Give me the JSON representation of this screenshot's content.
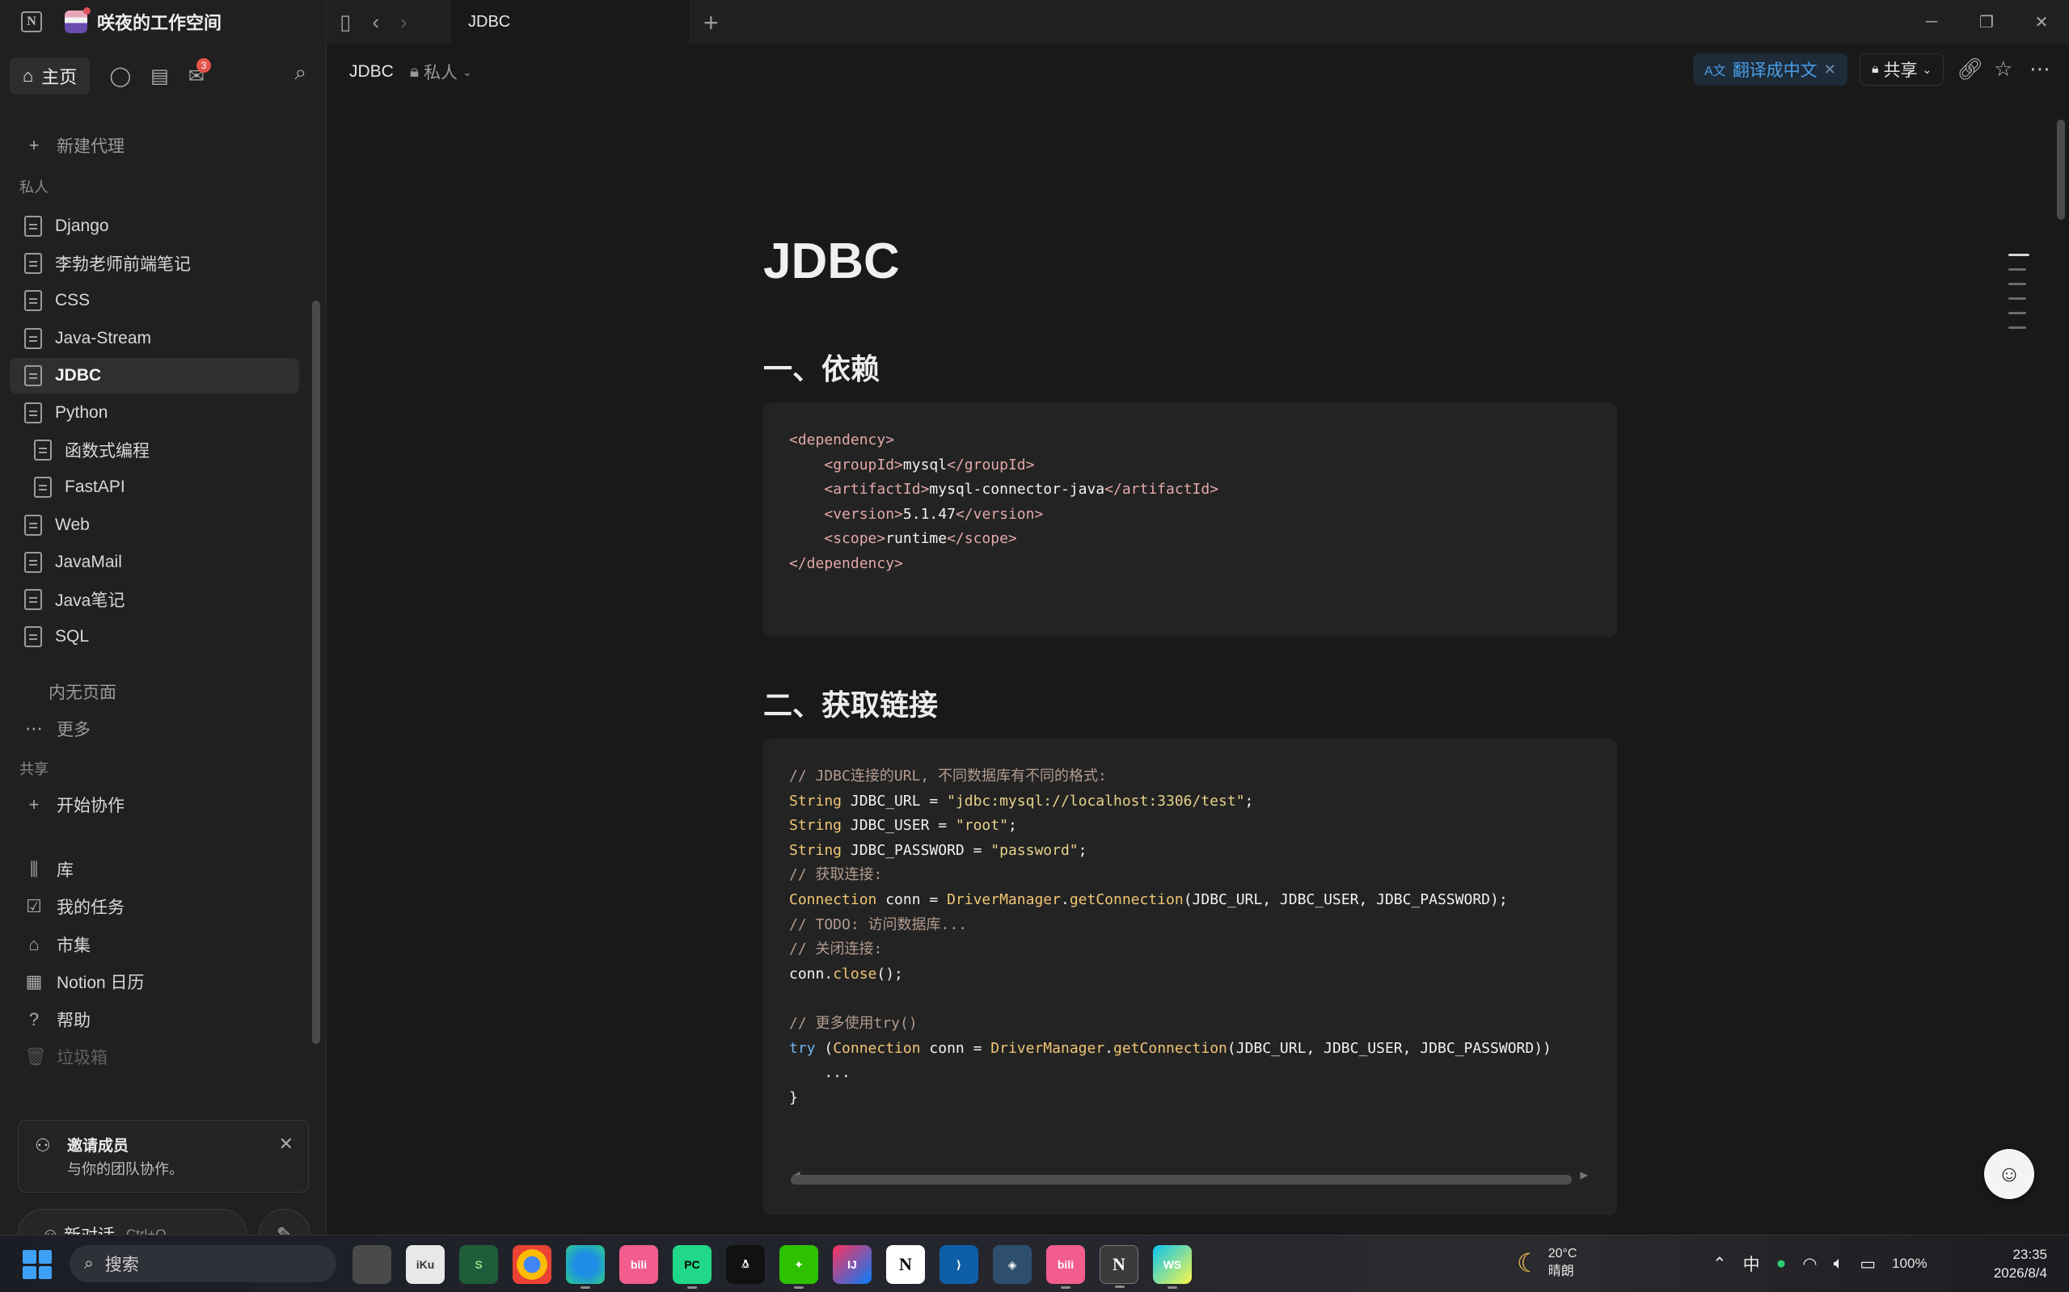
{
  "window": {
    "workspace_name": "咲夜的工作空间",
    "tab_title": "JDBC",
    "new_tab_icon": "plus-icon"
  },
  "sidebar": {
    "home_label": "主页",
    "new_agent": "新建代理",
    "inbox_badge": "3",
    "private_section": "私人",
    "pages": [
      {
        "label": "Django",
        "indent": 0
      },
      {
        "label": "李勃老师前端笔记",
        "indent": 0
      },
      {
        "label": "CSS",
        "indent": 0
      },
      {
        "label": "Java-Stream",
        "indent": 0
      },
      {
        "label": "JDBC",
        "indent": 0,
        "active": true
      },
      {
        "label": "Python",
        "indent": 0
      },
      {
        "label": "函数式编程",
        "indent": 1
      },
      {
        "label": "FastAPI",
        "indent": 1
      },
      {
        "label": "Web",
        "indent": 0
      },
      {
        "label": "JavaMail",
        "indent": 0
      },
      {
        "label": "Java笔记",
        "indent": 0
      },
      {
        "label": "SQL",
        "indent": 0
      }
    ],
    "no_pages": "内无页面",
    "more": "更多",
    "shared_section": "共享",
    "start_collab": "开始协作",
    "bottom_items": [
      {
        "label": "库",
        "icon": "library-icon"
      },
      {
        "label": "我的任务",
        "icon": "checkbox-icon"
      },
      {
        "label": "市集",
        "icon": "marketplace-icon"
      },
      {
        "label": "Notion 日历",
        "icon": "calendar-icon"
      },
      {
        "label": "帮助",
        "icon": "help-icon"
      },
      {
        "label": "垃圾箱",
        "icon": "trash-icon"
      }
    ],
    "invite": {
      "title": "邀请成员",
      "subtitle": "与你的团队协作。"
    },
    "new_chat": {
      "label": "新对话",
      "shortcut": "Ctrl+O"
    }
  },
  "header": {
    "breadcrumb": "JDBC",
    "privacy": "私人",
    "translate": "翻译成中文",
    "share": "共享"
  },
  "page": {
    "title": "JDBC",
    "sections": [
      {
        "heading": "一、依赖"
      },
      {
        "heading": "二、获取链接"
      }
    ]
  },
  "taskbar": {
    "search": "搜索",
    "weather_temp": "20°C",
    "weather_desc": "晴朗",
    "ime": "中",
    "battery": "100%",
    "time": "23:35",
    "date": "2026/8/4"
  },
  "colors": {
    "accent_blue": "#4a9ee8",
    "background": "#191919",
    "sidebar": "#202020",
    "code_bg": "#232323"
  }
}
